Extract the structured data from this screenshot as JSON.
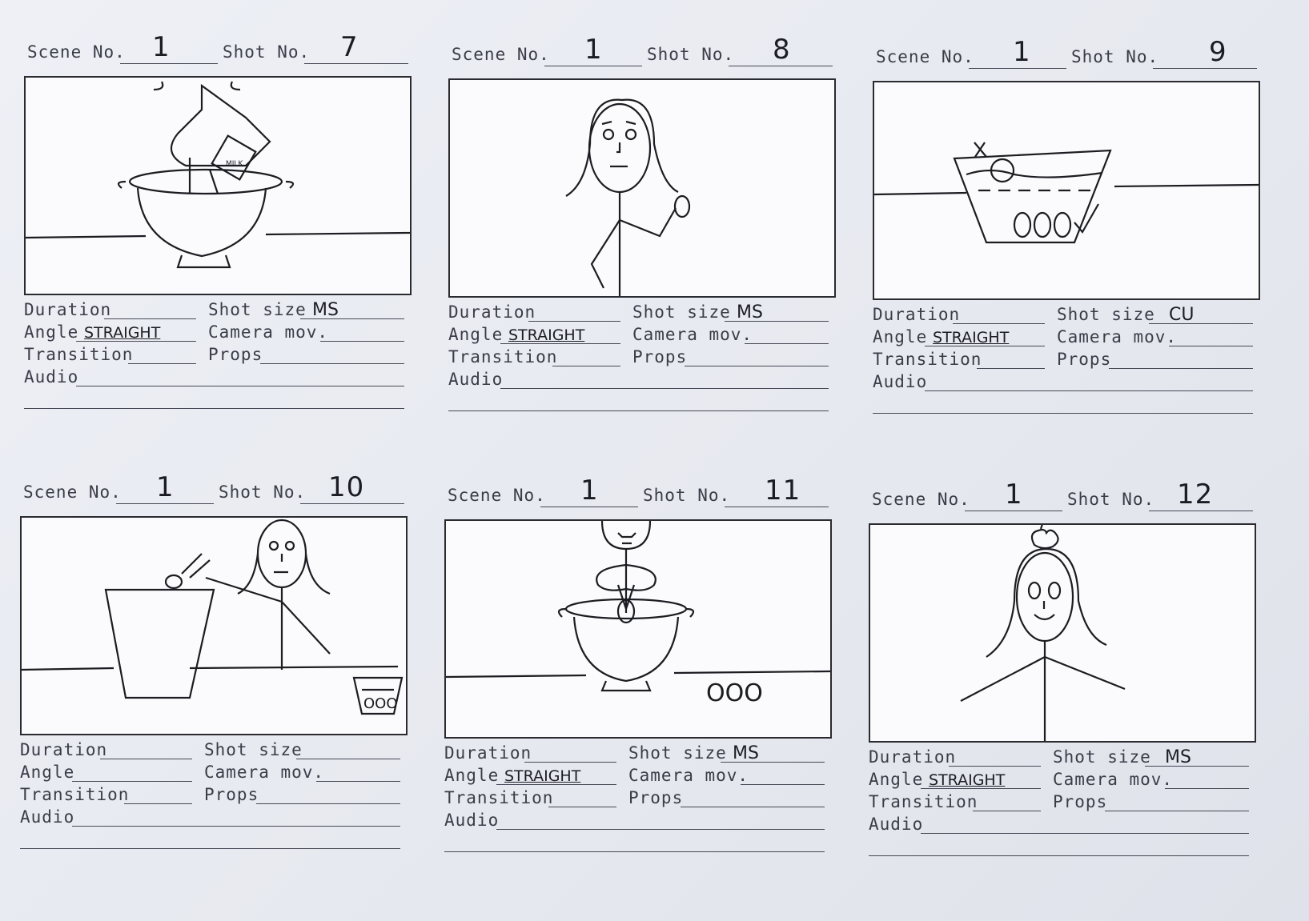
{
  "form_labels": {
    "scene": "Scene No.",
    "shot": "Shot No.",
    "duration": "Duration",
    "shot_size": "Shot size",
    "angle": "Angle",
    "camera": "Camera mov.",
    "transition": "Transition",
    "props": "Props",
    "audio": "Audio"
  },
  "panels": [
    {
      "scene": "1",
      "shot": "7",
      "shot_size": "MS",
      "angle": "STRAIGHT",
      "duration": "",
      "camera": "",
      "transition": "",
      "props": "",
      "audio": "",
      "sketch": "woman mixing in bowl with carton"
    },
    {
      "scene": "1",
      "shot": "8",
      "shot_size": "MS",
      "angle": "STRAIGHT",
      "duration": "",
      "camera": "",
      "transition": "",
      "props": "",
      "audio": "",
      "sketch": "woman holding egg"
    },
    {
      "scene": "1",
      "shot": "9",
      "shot_size": "CU",
      "angle": "STRAIGHT",
      "duration": "",
      "camera": "",
      "transition": "",
      "props": "",
      "audio": "",
      "sketch": "bowl of water with eggs"
    },
    {
      "scene": "1",
      "shot": "10",
      "shot_size": "",
      "angle": "",
      "duration": "",
      "camera": "",
      "transition": "",
      "props": "",
      "audio": "",
      "sketch": "woman throwing egg into bin"
    },
    {
      "scene": "1",
      "shot": "11",
      "shot_size": "MS",
      "angle": "STRAIGHT",
      "duration": "",
      "camera": "",
      "transition": "",
      "props": "",
      "audio": "",
      "sketch": "woman mixing with whisk"
    },
    {
      "scene": "1",
      "shot": "12",
      "shot_size": "MS",
      "angle": "STRAIGHT",
      "duration": "",
      "camera": "",
      "transition": "",
      "props": "",
      "audio": "",
      "sketch": "woman with apple on head"
    }
  ],
  "sketch_text": {
    "carton": "MILK",
    "eggs_label": "OOO",
    "eggs_label_11": "OOO"
  }
}
